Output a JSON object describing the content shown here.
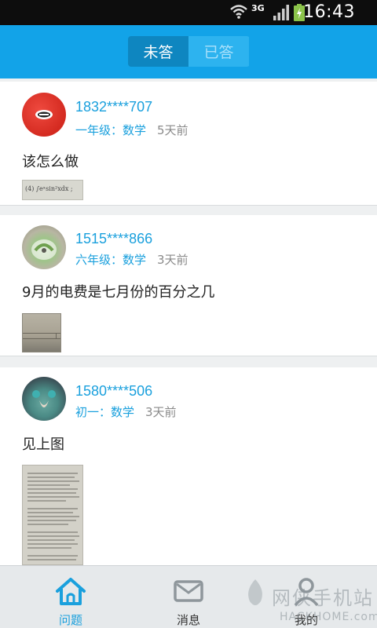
{
  "status_bar": {
    "network": "3G",
    "time": "16:43"
  },
  "header": {
    "tabs": [
      {
        "label": "未答",
        "active": true
      },
      {
        "label": "已答",
        "active": false
      }
    ]
  },
  "feed": [
    {
      "user": "1832****707",
      "grade": "一年级：数学",
      "time_ago": "5天前",
      "question": "该怎么做",
      "image_text": "(4) ∫eˣsin²xdx ;"
    },
    {
      "user": "1515****866",
      "grade": "六年级：数学",
      "time_ago": "3天前",
      "question": "9月的电费是七月份的百分之几"
    },
    {
      "user": "1580****506",
      "grade": "初一：数学",
      "time_ago": "3天前",
      "question": "见上图"
    }
  ],
  "bottom_nav": [
    {
      "label": "问题",
      "icon": "home-icon",
      "active": true
    },
    {
      "label": "消息",
      "icon": "mail-icon",
      "active": false
    },
    {
      "label": "我的",
      "icon": "person-icon",
      "active": false
    }
  ],
  "watermark": {
    "name": "网侠手机站",
    "url": "HACKHOME.com"
  },
  "colors": {
    "accent": "#12a3e8",
    "link": "#1aa0dd"
  }
}
